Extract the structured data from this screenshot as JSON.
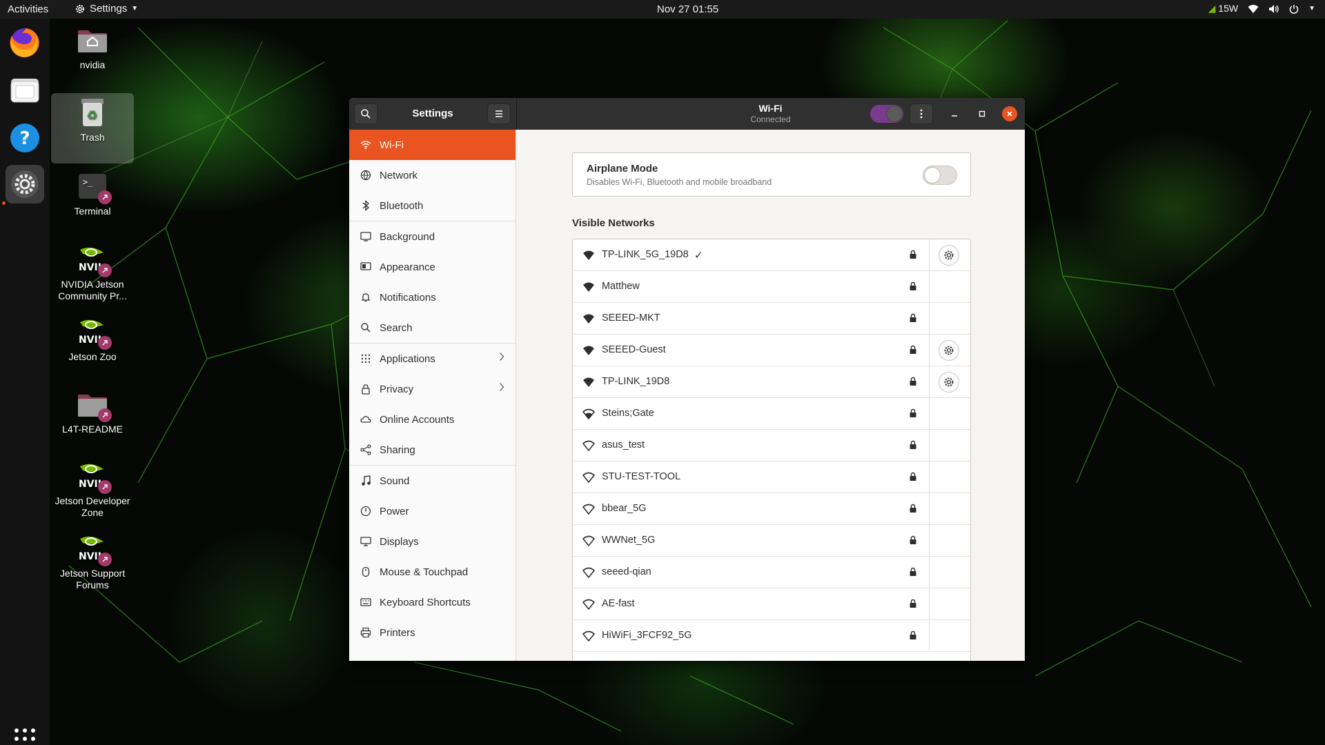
{
  "topbar": {
    "activities": "Activities",
    "app_menu": "Settings",
    "clock": "Nov 27  01:55",
    "power_mode": "15W"
  },
  "dock": {
    "items": [
      "firefox-icon",
      "files-icon",
      "help-icon",
      "settings-icon"
    ],
    "active": "settings-icon"
  },
  "desktop": {
    "icons": [
      {
        "label": "nvidia",
        "icon": "home-folder-icon"
      },
      {
        "label": "Trash",
        "icon": "trash-icon"
      },
      {
        "label": "Terminal",
        "icon": "terminal-icon"
      },
      {
        "label": "NVIDIA Jetson Community Pr...",
        "icon": "nvidia-icon"
      },
      {
        "label": "Jetson Zoo",
        "icon": "nvidia-icon"
      },
      {
        "label": "L4T-README",
        "icon": "folder-icon"
      },
      {
        "label": "Jetson Developer Zone",
        "icon": "nvidia-icon"
      },
      {
        "label": "Jetson Support Forums",
        "icon": "nvidia-icon"
      }
    ]
  },
  "window": {
    "sidebar_title": "Settings",
    "page_title": "Wi-Fi",
    "page_subtitle": "Connected",
    "wifi_enabled": true
  },
  "sidebar": {
    "items": [
      {
        "label": "Wi-Fi",
        "icon": "wifi-icon",
        "selected": true
      },
      {
        "label": "Network",
        "icon": "network-icon"
      },
      {
        "label": "Bluetooth",
        "icon": "bluetooth-icon"
      },
      {
        "label": "Background",
        "icon": "background-icon"
      },
      {
        "label": "Appearance",
        "icon": "appearance-icon"
      },
      {
        "label": "Notifications",
        "icon": "bell-icon"
      },
      {
        "label": "Search",
        "icon": "search-icon"
      },
      {
        "label": "Applications",
        "icon": "grid-icon",
        "chevron": true
      },
      {
        "label": "Privacy",
        "icon": "lock-icon",
        "chevron": true
      },
      {
        "label": "Online Accounts",
        "icon": "cloud-icon"
      },
      {
        "label": "Sharing",
        "icon": "share-icon"
      },
      {
        "label": "Sound",
        "icon": "music-note-icon"
      },
      {
        "label": "Power",
        "icon": "power-icon"
      },
      {
        "label": "Displays",
        "icon": "display-icon"
      },
      {
        "label": "Mouse & Touchpad",
        "icon": "mouse-icon"
      },
      {
        "label": "Keyboard Shortcuts",
        "icon": "keyboard-icon"
      },
      {
        "label": "Printers",
        "icon": "printer-icon"
      }
    ]
  },
  "airplane": {
    "title": "Airplane Mode",
    "description": "Disables Wi-Fi, Bluetooth and mobile broadband",
    "enabled": false
  },
  "visible_networks": {
    "label": "Visible Networks",
    "networks": [
      {
        "ssid": "TP-LINK_5G_19D8",
        "connected": true,
        "secured": true,
        "strength": "full",
        "has_settings": true
      },
      {
        "ssid": "Matthew",
        "secured": true,
        "strength": "full"
      },
      {
        "ssid": "SEEED-MKT",
        "secured": true,
        "strength": "full"
      },
      {
        "ssid": "SEEED-Guest",
        "secured": true,
        "strength": "full",
        "has_settings": true
      },
      {
        "ssid": "TP-LINK_19D8",
        "secured": true,
        "strength": "full",
        "has_settings": true
      },
      {
        "ssid": "Steins;Gate",
        "secured": true,
        "strength": "medium"
      },
      {
        "ssid": "asus_test",
        "secured": true,
        "strength": "weak"
      },
      {
        "ssid": "STU-TEST-TOOL",
        "secured": true,
        "strength": "weak"
      },
      {
        "ssid": "bbear_5G",
        "secured": true,
        "strength": "weak"
      },
      {
        "ssid": "WWNet_5G",
        "secured": true,
        "strength": "weak"
      },
      {
        "ssid": "seeed-qian",
        "secured": true,
        "strength": "weak"
      },
      {
        "ssid": "AE-fast",
        "secured": true,
        "strength": "weak"
      },
      {
        "ssid": "HiWiFi_3FCF92_5G",
        "secured": true,
        "strength": "weak"
      }
    ]
  },
  "colors": {
    "accent": "#e95420",
    "toggle_on": "#7a3b8f",
    "nvidia_green": "#76b900",
    "headerbar": "#303030"
  }
}
